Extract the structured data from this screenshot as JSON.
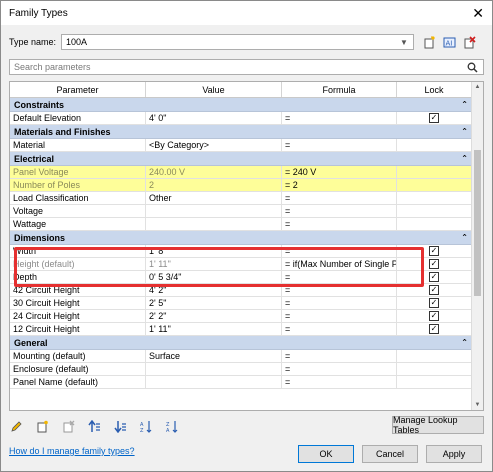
{
  "window": {
    "title": "Family Types",
    "close": "✕"
  },
  "type_name": {
    "label": "Type name:",
    "value": "100A"
  },
  "search": {
    "placeholder": "Search parameters"
  },
  "columns": {
    "parameter": "Parameter",
    "value": "Value",
    "formula": "Formula",
    "lock": "Lock"
  },
  "groups": {
    "constraints": "Constraints",
    "materials": "Materials and Finishes",
    "electrical": "Electrical",
    "dimensions": "Dimensions",
    "general": "General"
  },
  "rows": {
    "default_elevation": {
      "param": "Default Elevation",
      "value": "4'  0\"",
      "formula": "="
    },
    "material": {
      "param": "Material",
      "value": "<By Category>",
      "formula": "="
    },
    "panel_voltage": {
      "param": "Panel Voltage",
      "value": "240.00 V",
      "formula": "= 240 V"
    },
    "number_of_poles": {
      "param": "Number of Poles",
      "value": "2",
      "formula": "= 2"
    },
    "load_classification": {
      "param": "Load Classification",
      "value": "Other",
      "formula": "="
    },
    "voltage": {
      "param": "Voltage",
      "value": "",
      "formula": "="
    },
    "wattage": {
      "param": "Wattage",
      "value": "",
      "formula": "="
    },
    "width": {
      "param": "Width",
      "value": "1'  8\"",
      "formula": "="
    },
    "height": {
      "param": "Height (default)",
      "value": "1'  11\"",
      "formula": "= if(Max Number of Single P"
    },
    "depth": {
      "param": "Depth",
      "value": "0'  5 3/4\"",
      "formula": "="
    },
    "h42": {
      "param": "42 Circuit Height",
      "value": "4'  2\"",
      "formula": "="
    },
    "h30": {
      "param": "30 Circuit Height",
      "value": "2'  5\"",
      "formula": "="
    },
    "h24": {
      "param": "24 Circuit Height",
      "value": "2'  2\"",
      "formula": "="
    },
    "h12": {
      "param": "12 Circuit Height",
      "value": "1'  11\"",
      "formula": "="
    },
    "mounting": {
      "param": "Mounting (default)",
      "value": "Surface",
      "formula": "="
    },
    "enclosure": {
      "param": "Enclosure (default)",
      "value": "",
      "formula": "="
    },
    "panel_name": {
      "param": "Panel Name (default)",
      "value": "",
      "formula": "="
    }
  },
  "buttons": {
    "manage_lookup": "Manage Lookup Tables",
    "ok": "OK",
    "cancel": "Cancel",
    "apply": "Apply"
  },
  "help_link": "How do I manage family types?",
  "colors": {
    "group_bg": "#c9d7ec",
    "highlight_bg": "#fefe99",
    "highlight_border": "#e53030",
    "link": "#0064c8"
  }
}
